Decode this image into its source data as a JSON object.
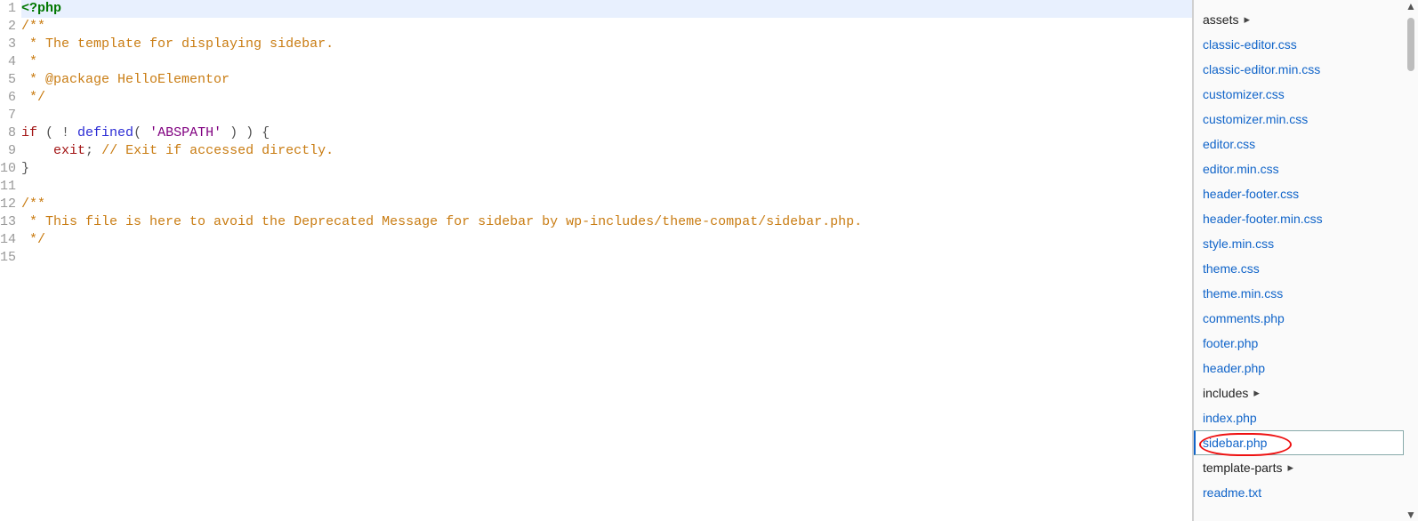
{
  "code_lines": [
    {
      "n": 1,
      "hl": true,
      "tokens": [
        {
          "t": "<?",
          "c": "tok-proc"
        },
        {
          "t": "php",
          "c": "tok-proc"
        }
      ]
    },
    {
      "n": 2,
      "tokens": [
        {
          "t": "/**",
          "c": "tok-comment"
        }
      ]
    },
    {
      "n": 3,
      "tokens": [
        {
          "t": " * The template for displaying sidebar.",
          "c": "tok-comment"
        }
      ]
    },
    {
      "n": 4,
      "tokens": [
        {
          "t": " *",
          "c": "tok-comment"
        }
      ]
    },
    {
      "n": 5,
      "tokens": [
        {
          "t": " * @package HelloElementor",
          "c": "tok-comment"
        }
      ]
    },
    {
      "n": 6,
      "tokens": [
        {
          "t": " */",
          "c": "tok-comment"
        }
      ]
    },
    {
      "n": 7,
      "tokens": [
        {
          "t": "",
          "c": ""
        }
      ]
    },
    {
      "n": 8,
      "tokens": [
        {
          "t": "if",
          "c": "tok-kwd"
        },
        {
          "t": " ( ! ",
          "c": "tok-punc"
        },
        {
          "t": "defined",
          "c": "tok-fn"
        },
        {
          "t": "( ",
          "c": "tok-punc"
        },
        {
          "t": "'ABSPATH'",
          "c": "tok-str"
        },
        {
          "t": " ) ) {",
          "c": "tok-punc"
        }
      ]
    },
    {
      "n": 9,
      "tokens": [
        {
          "t": "    ",
          "c": ""
        },
        {
          "t": "exit",
          "c": "tok-kwd"
        },
        {
          "t": ";",
          "c": "tok-punc"
        },
        {
          "t": " // Exit if accessed directly.",
          "c": "tok-comment"
        }
      ]
    },
    {
      "n": 10,
      "tokens": [
        {
          "t": "}",
          "c": "tok-punc"
        }
      ]
    },
    {
      "n": 11,
      "tokens": [
        {
          "t": "",
          "c": ""
        }
      ]
    },
    {
      "n": 12,
      "tokens": [
        {
          "t": "/**",
          "c": "tok-comment"
        }
      ]
    },
    {
      "n": 13,
      "tokens": [
        {
          "t": " * This file is here to avoid the Deprecated Message for sidebar by wp-includes/theme-compat/sidebar.php.",
          "c": "tok-comment"
        }
      ]
    },
    {
      "n": 14,
      "tokens": [
        {
          "t": " */",
          "c": "tok-comment"
        }
      ]
    },
    {
      "n": 15,
      "tokens": [
        {
          "t": "",
          "c": ""
        }
      ]
    }
  ],
  "explorer": {
    "items": [
      {
        "label": "assets",
        "type": "folder"
      },
      {
        "label": "classic-editor.css",
        "type": "file"
      },
      {
        "label": "classic-editor.min.css",
        "type": "file"
      },
      {
        "label": "customizer.css",
        "type": "file"
      },
      {
        "label": "customizer.min.css",
        "type": "file"
      },
      {
        "label": "editor.css",
        "type": "file"
      },
      {
        "label": "editor.min.css",
        "type": "file"
      },
      {
        "label": "header-footer.css",
        "type": "file"
      },
      {
        "label": "header-footer.min.css",
        "type": "file"
      },
      {
        "label": "style.min.css",
        "type": "file"
      },
      {
        "label": "theme.css",
        "type": "file"
      },
      {
        "label": "theme.min.css",
        "type": "file"
      },
      {
        "label": "comments.php",
        "type": "file"
      },
      {
        "label": "footer.php",
        "type": "file"
      },
      {
        "label": "header.php",
        "type": "file"
      },
      {
        "label": "includes",
        "type": "folder"
      },
      {
        "label": "index.php",
        "type": "file"
      },
      {
        "label": "sidebar.php",
        "type": "file",
        "selected": true
      },
      {
        "label": "template-parts",
        "type": "folder"
      },
      {
        "label": "readme.txt",
        "type": "file"
      }
    ]
  }
}
